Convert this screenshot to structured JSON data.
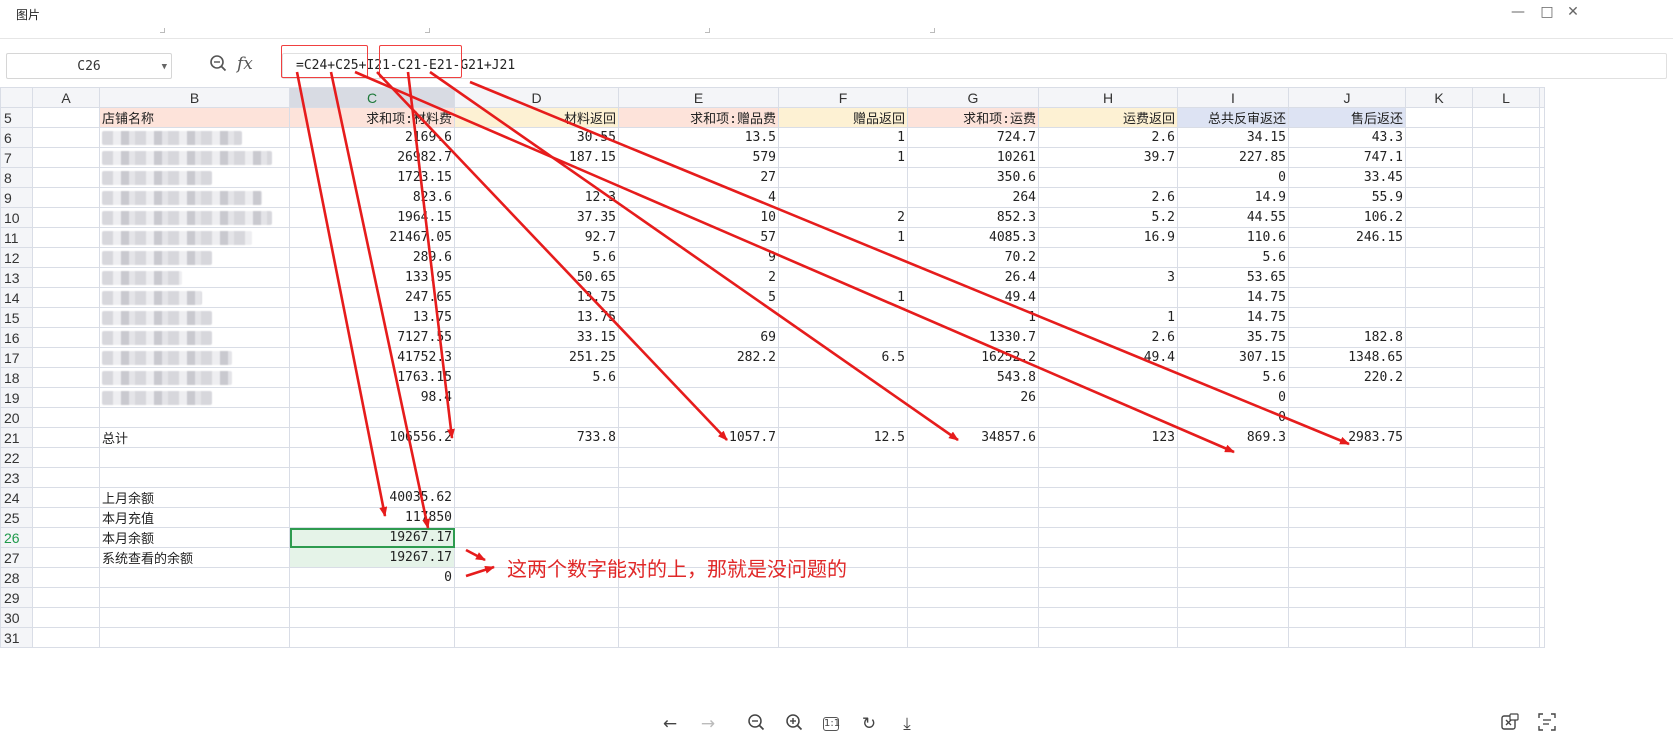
{
  "window": {
    "title": "图片"
  },
  "name_box": {
    "value": "C26"
  },
  "formula_bar": {
    "fx_label": "fx",
    "formula": "=C24+C25+I21-C21-E21-G21+J21"
  },
  "columns": [
    "A",
    "B",
    "C",
    "D",
    "E",
    "F",
    "G",
    "H",
    "I",
    "J",
    "K",
    "L"
  ],
  "header_row": {
    "num": "5",
    "B": "店铺名称",
    "C": "求和项:材料费",
    "D": "材料返回",
    "E": "求和项:赠品费",
    "F": "赠品返回",
    "G": "求和项:运费",
    "H": "运费返回",
    "I": "总共反审返还",
    "J": "售后返还"
  },
  "data_rows": [
    {
      "num": "6",
      "C": "2169.6",
      "D": "30.55",
      "E": "13.5",
      "F": "1",
      "G": "724.7",
      "H": "2.6",
      "I": "34.15",
      "J": "43.3"
    },
    {
      "num": "7",
      "C": "26982.7",
      "D": "187.15",
      "E": "579",
      "F": "1",
      "G": "10261",
      "H": "39.7",
      "I": "227.85",
      "J": "747.1"
    },
    {
      "num": "8",
      "C": "1723.15",
      "D": "",
      "E": "27",
      "F": "",
      "G": "350.6",
      "H": "",
      "I": "0",
      "J": "33.45"
    },
    {
      "num": "9",
      "C": "823.6",
      "D": "12.3",
      "E": "4",
      "F": "",
      "G": "264",
      "H": "2.6",
      "I": "14.9",
      "J": "55.9"
    },
    {
      "num": "10",
      "C": "1964.15",
      "D": "37.35",
      "E": "10",
      "F": "2",
      "G": "852.3",
      "H": "5.2",
      "I": "44.55",
      "J": "106.2"
    },
    {
      "num": "11",
      "C": "21467.05",
      "D": "92.7",
      "E": "57",
      "F": "1",
      "G": "4085.3",
      "H": "16.9",
      "I": "110.6",
      "J": "246.15"
    },
    {
      "num": "12",
      "C": "289.6",
      "D": "5.6",
      "E": "9",
      "F": "",
      "G": "70.2",
      "H": "",
      "I": "5.6",
      "J": ""
    },
    {
      "num": "13",
      "C": "133.95",
      "D": "50.65",
      "E": "2",
      "F": "",
      "G": "26.4",
      "H": "3",
      "I": "53.65",
      "J": ""
    },
    {
      "num": "14",
      "C": "247.65",
      "D": "13.75",
      "E": "5",
      "F": "1",
      "G": "49.4",
      "H": "",
      "I": "14.75",
      "J": ""
    },
    {
      "num": "15",
      "C": "13.75",
      "D": "13.75",
      "E": "",
      "F": "",
      "G": "1",
      "H": "1",
      "I": "14.75",
      "J": ""
    },
    {
      "num": "16",
      "C": "7127.55",
      "D": "33.15",
      "E": "69",
      "F": "",
      "G": "1330.7",
      "H": "2.6",
      "I": "35.75",
      "J": "182.8"
    },
    {
      "num": "17",
      "C": "41752.3",
      "D": "251.25",
      "E": "282.2",
      "F": "6.5",
      "G": "16252.2",
      "H": "49.4",
      "I": "307.15",
      "J": "1348.65"
    },
    {
      "num": "18",
      "C": "1763.15",
      "D": "5.6",
      "E": "",
      "F": "",
      "G": "543.8",
      "H": "",
      "I": "5.6",
      "J": "220.2"
    },
    {
      "num": "19",
      "C": "98.4",
      "D": "",
      "E": "",
      "F": "",
      "G": "26",
      "H": "",
      "I": "0",
      "J": ""
    },
    {
      "num": "20",
      "C": "",
      "D": "",
      "E": "",
      "F": "",
      "G": "",
      "H": "",
      "I": "0",
      "J": ""
    }
  ],
  "total_row": {
    "num": "21",
    "B": "总计",
    "C": "106556.2",
    "D": "733.8",
    "E": "1057.7",
    "F": "12.5",
    "G": "34857.6",
    "H": "123",
    "I": "869.3",
    "J": "2983.75"
  },
  "empty_rows_a": [
    "22",
    "23"
  ],
  "balance_rows": [
    {
      "num": "24",
      "B": "上月余额",
      "C": "40035.62"
    },
    {
      "num": "25",
      "B": "本月充值",
      "C": "117850"
    },
    {
      "num": "26",
      "B": "本月余额",
      "C": "19267.17"
    },
    {
      "num": "27",
      "B": "系统查看的余额",
      "C": "19267.17"
    },
    {
      "num": "28",
      "B": "",
      "C": "0"
    }
  ],
  "empty_rows_b": [
    "29",
    "30",
    "31"
  ],
  "annotation": {
    "note": "这两个数字能对的上，那就是没问题的",
    "accent_color": "#e02828"
  },
  "bottom_toolbar": [
    "arrow-left-icon",
    "arrow-right-icon",
    "zoom-out-icon",
    "zoom-in-icon",
    "actual-size-icon",
    "rotate-icon",
    "download-icon",
    "excel-icon",
    "ocr-icon"
  ],
  "bottom_toolbar_labels": {
    "actual_size": "1:1"
  }
}
